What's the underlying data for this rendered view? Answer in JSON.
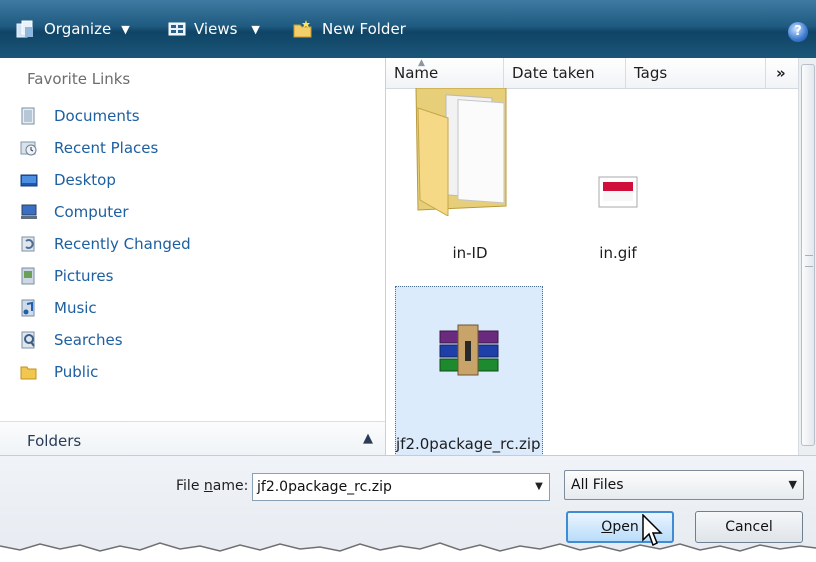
{
  "toolbar": {
    "organize": "Organize",
    "views": "Views",
    "new_folder": "New Folder",
    "help": "?"
  },
  "favorites": {
    "title": "Favorite Links",
    "items": [
      {
        "label": "Documents",
        "icon": "documents-icon"
      },
      {
        "label": "Recent Places",
        "icon": "recent-places-icon"
      },
      {
        "label": "Desktop",
        "icon": "desktop-icon"
      },
      {
        "label": "Computer",
        "icon": "computer-icon"
      },
      {
        "label": "Recently Changed",
        "icon": "recently-changed-icon"
      },
      {
        "label": "Pictures",
        "icon": "pictures-icon"
      },
      {
        "label": "Music",
        "icon": "music-icon"
      },
      {
        "label": "Searches",
        "icon": "searches-icon"
      },
      {
        "label": "Public",
        "icon": "public-icon"
      }
    ],
    "folders_label": "Folders"
  },
  "columns": [
    "Name",
    "Date taken",
    "Tags"
  ],
  "files": [
    {
      "name": "in-ID",
      "type": "folder"
    },
    {
      "name": "in.gif",
      "type": "gif"
    },
    {
      "name": "jf2.0package_rc.zip",
      "type": "zip",
      "selected": true
    }
  ],
  "bottom": {
    "file_name_label_prefix": "File ",
    "file_name_label_underlined": "n",
    "file_name_label_suffix": "ame:",
    "file_name_value": "jf2.0package_rc.zip",
    "file_type_value": "All Files",
    "open_underlined": "O",
    "open_rest": "pen",
    "cancel_label": "Cancel"
  }
}
